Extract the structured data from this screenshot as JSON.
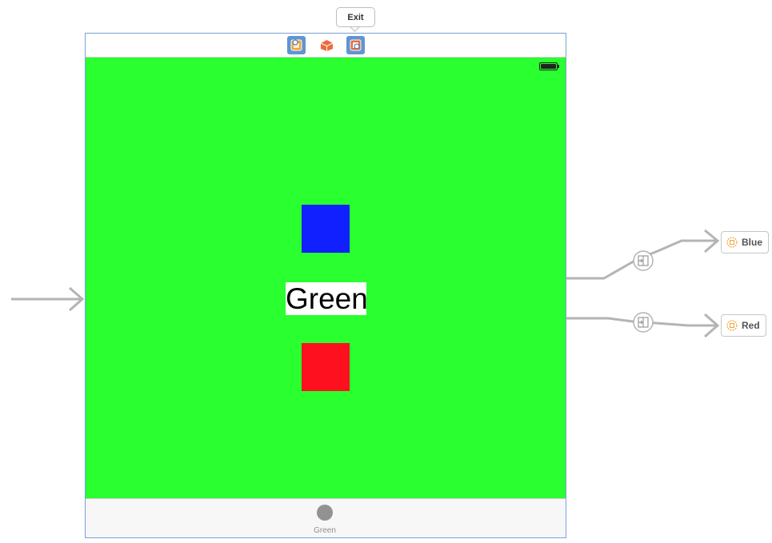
{
  "callout": {
    "exit_label": "Exit"
  },
  "scene": {
    "dock_icons": [
      "view-controller-icon",
      "first-responder-icon",
      "exit-icon"
    ],
    "main_label": "Green",
    "background_color": "#2aff2f",
    "squares": [
      {
        "name": "blue-square",
        "color": "#1020ff"
      },
      {
        "name": "red-square",
        "color": "#ff101e"
      }
    ],
    "tab_bar": {
      "item_label": "Green"
    }
  },
  "segue_destinations": [
    {
      "label": "Blue",
      "icon": "scene-icon"
    },
    {
      "label": "Red",
      "icon": "scene-icon"
    }
  ],
  "colors": {
    "frame_border": "#7aa1d8",
    "segue_line": "#b4b4b4",
    "dock_icon_bg": "#5f95d2"
  }
}
